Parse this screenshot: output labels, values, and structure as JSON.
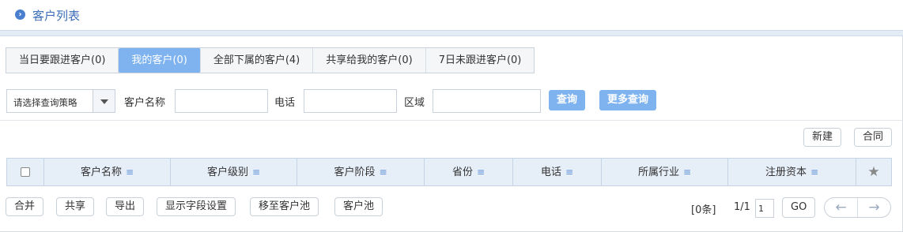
{
  "header": {
    "title": "客户列表",
    "icon": "chevron-right-circle-icon"
  },
  "tabs": [
    {
      "label": "当日要跟进客户(0)",
      "active": false
    },
    {
      "label": "我的客户(0)",
      "active": true
    },
    {
      "label": "全部下属的客户(4)",
      "active": false
    },
    {
      "label": "共享给我的客户(0)",
      "active": false
    },
    {
      "label": "7日未跟进客户(0)",
      "active": false
    }
  ],
  "filters": {
    "strategy_select": "请选择查询策略",
    "name_label": "客户名称",
    "phone_label": "电话",
    "region_label": "区域",
    "query_button": "查询",
    "more_query_button": "更多查询"
  },
  "toolbar": {
    "new_button": "新建",
    "contract_button": "合同"
  },
  "table": {
    "columns": [
      "客户名称",
      "客户级别",
      "客户阶段",
      "省份",
      "电话",
      "所属行业",
      "注册资本"
    ],
    "menu_icon": "≡",
    "star_icon": "★"
  },
  "bulk_actions": [
    "合并",
    "共享",
    "导出",
    "显示字段设置",
    "移至客户池",
    "客户池"
  ],
  "pagination": {
    "count": "[0条]",
    "page_info": "1/1",
    "page_input": "1",
    "go_button": "GO",
    "prev_icon": "←",
    "next_icon": "→"
  },
  "colors": {
    "accent": "#7eb3ef",
    "title": "#3b6db8",
    "header_bg": "#e6eef8"
  }
}
